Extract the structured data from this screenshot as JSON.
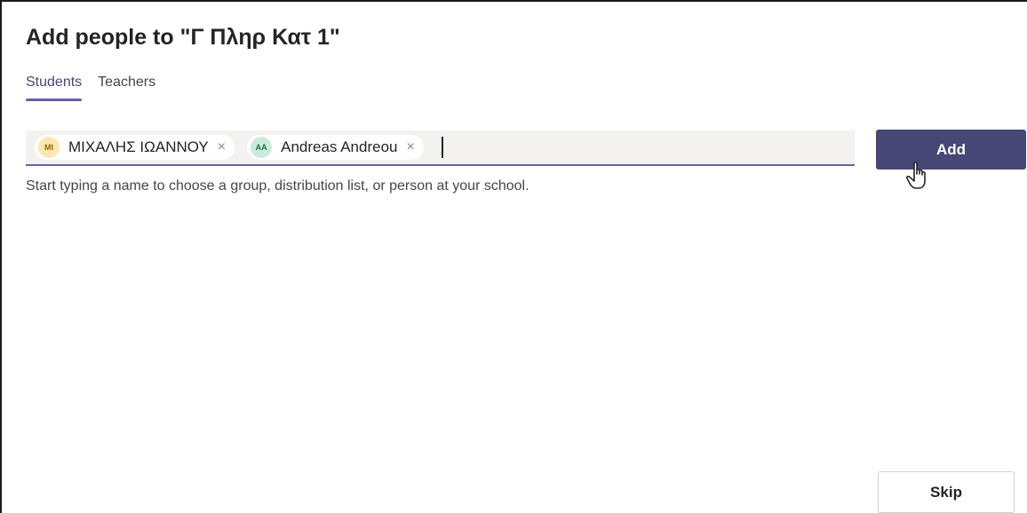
{
  "dialog": {
    "title": "Add people to \"Γ Πληρ Κατ 1\""
  },
  "tabs": [
    {
      "label": "Students",
      "active": true
    },
    {
      "label": "Teachers",
      "active": false
    }
  ],
  "picker": {
    "chips": [
      {
        "initials": "MI",
        "name": "ΜΙΧΑΛΗΣ ΙΩΑΝΝΟΥ",
        "remove": "×",
        "avatar_bg": "#fde7b0",
        "avatar_fg": "#8a6a00"
      },
      {
        "initials": "AA",
        "name": "Andreas Andreou",
        "remove": "×",
        "avatar_bg": "#c9ecd9",
        "avatar_fg": "#1b6e4a"
      }
    ],
    "hint": "Start typing a name to choose a group, distribution list, or person at your school."
  },
  "buttons": {
    "add_label": "Add",
    "skip_label": "Skip"
  },
  "colors": {
    "accent": "#6264a7",
    "primary_button": "#464775"
  },
  "icons": {
    "pointer": "hand-pointer-icon"
  }
}
